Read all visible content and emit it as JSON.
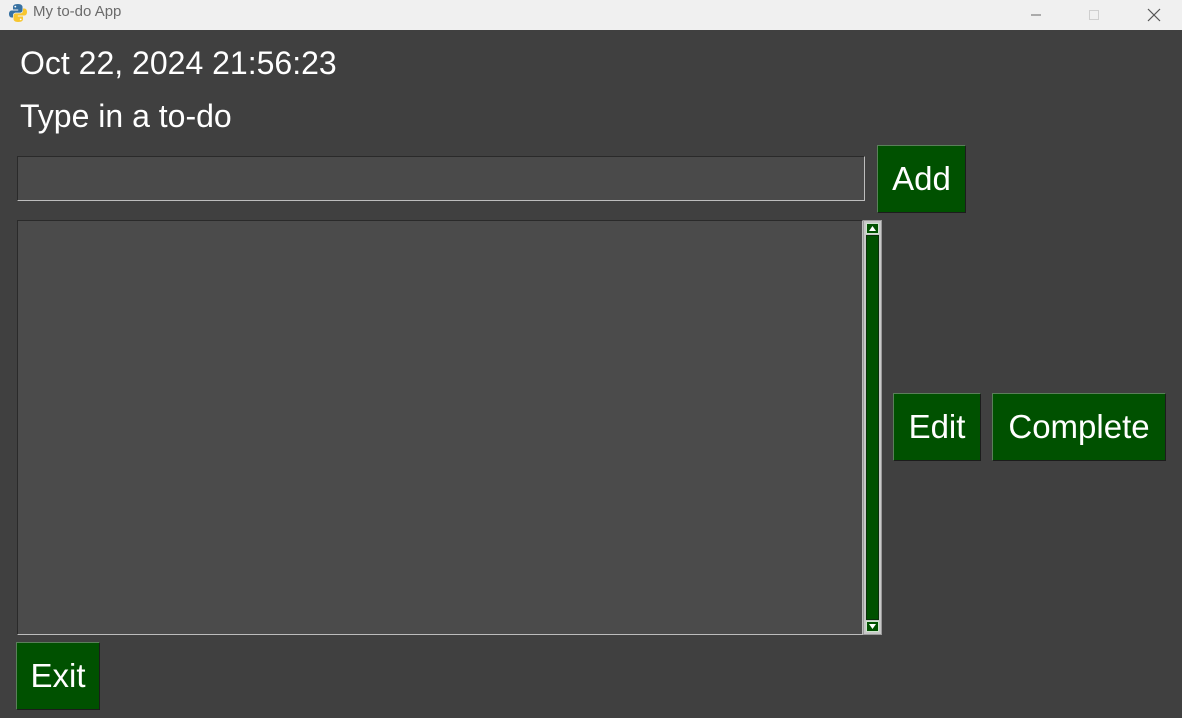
{
  "window": {
    "title": "My to-do App",
    "controls": [
      "minimize-icon",
      "maximize-icon",
      "close-icon"
    ]
  },
  "clock": {
    "text": "Oct 22, 2024 21:56:23"
  },
  "prompt": {
    "label": "Type in a to-do"
  },
  "todo_input": {
    "value": "",
    "placeholder": ""
  },
  "buttons": {
    "add": "Add",
    "edit": "Edit",
    "complete": "Complete",
    "exit": "Exit"
  },
  "todos": {
    "items": []
  },
  "colors": {
    "background": "#404040",
    "button": "#005100",
    "field": "#4a4a4a",
    "titlebar": "#f0f0f0",
    "text": "#ffffff"
  }
}
